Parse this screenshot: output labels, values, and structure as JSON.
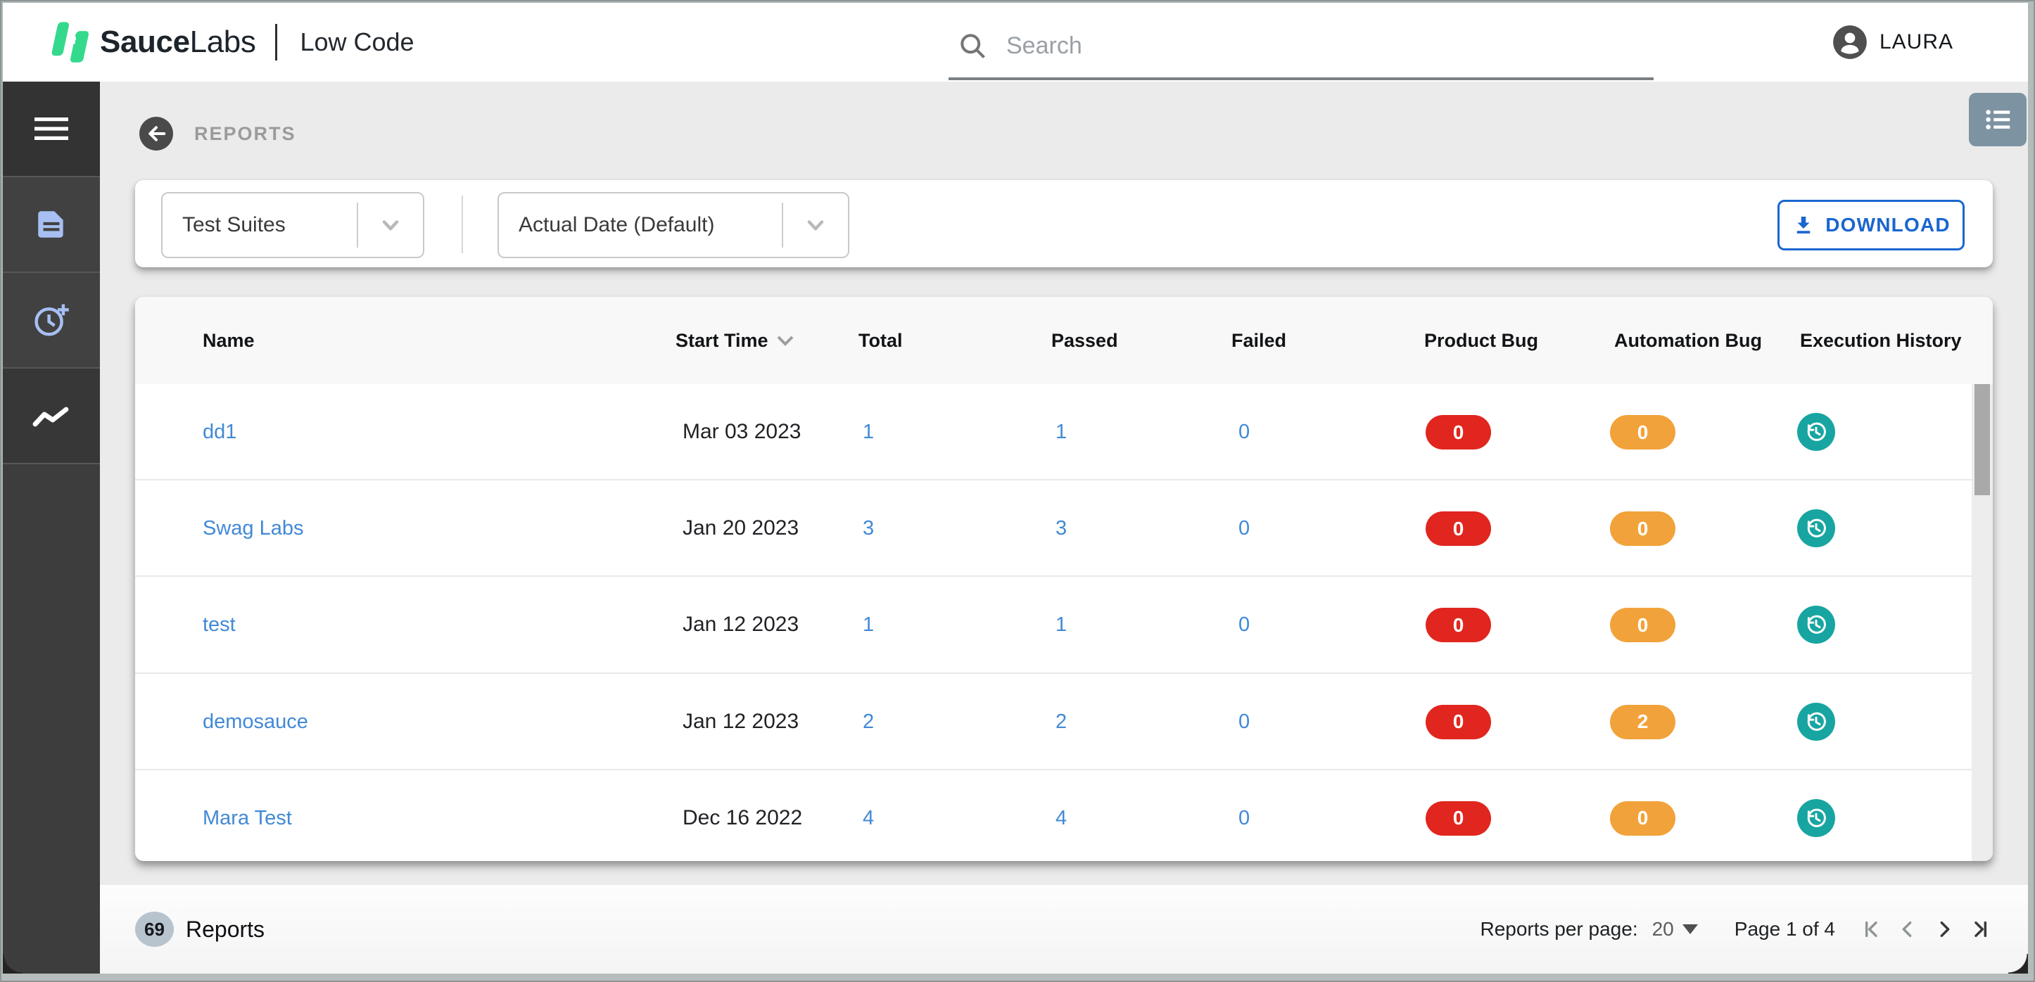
{
  "header": {
    "brand_bold": "Sauce",
    "brand_light": "Labs",
    "product": "Low Code",
    "search_placeholder": "Search",
    "user": "LAURA"
  },
  "page": {
    "title": "REPORTS"
  },
  "filters": {
    "suite_filter": "Test Suites",
    "date_filter": "Actual Date (Default)",
    "download_label": "DOWNLOAD"
  },
  "table": {
    "columns": [
      "Name",
      "Start Time",
      "Total",
      "Passed",
      "Failed",
      "Product Bug",
      "Automation Bug",
      "Execution History"
    ],
    "rows": [
      {
        "name": "dd1",
        "start": "Mar 03 2023",
        "total": "1",
        "passed": "1",
        "failed": "0",
        "product_bug": "0",
        "automation_bug": "0"
      },
      {
        "name": "Swag Labs",
        "start": "Jan 20 2023",
        "total": "3",
        "passed": "3",
        "failed": "0",
        "product_bug": "0",
        "automation_bug": "0"
      },
      {
        "name": "test",
        "start": "Jan 12 2023",
        "total": "1",
        "passed": "1",
        "failed": "0",
        "product_bug": "0",
        "automation_bug": "0"
      },
      {
        "name": "demosauce",
        "start": "Jan 12 2023",
        "total": "2",
        "passed": "2",
        "failed": "0",
        "product_bug": "0",
        "automation_bug": "2"
      },
      {
        "name": "Mara Test",
        "start": "Dec 16 2022",
        "total": "4",
        "passed": "4",
        "failed": "0",
        "product_bug": "0",
        "automation_bug": "0"
      }
    ]
  },
  "footer": {
    "count": "69",
    "count_label": "Reports",
    "per_page_label": "Reports per page:",
    "per_page": "20",
    "page_info": "Page 1 of 4"
  },
  "colors": {
    "brand_green": "#34d98c",
    "product_bug": "#e0261e",
    "automation_bug": "#f2a23a",
    "history_teal": "#18a5a1",
    "link_blue": "#4289d6",
    "download_blue": "#1a66cf"
  }
}
